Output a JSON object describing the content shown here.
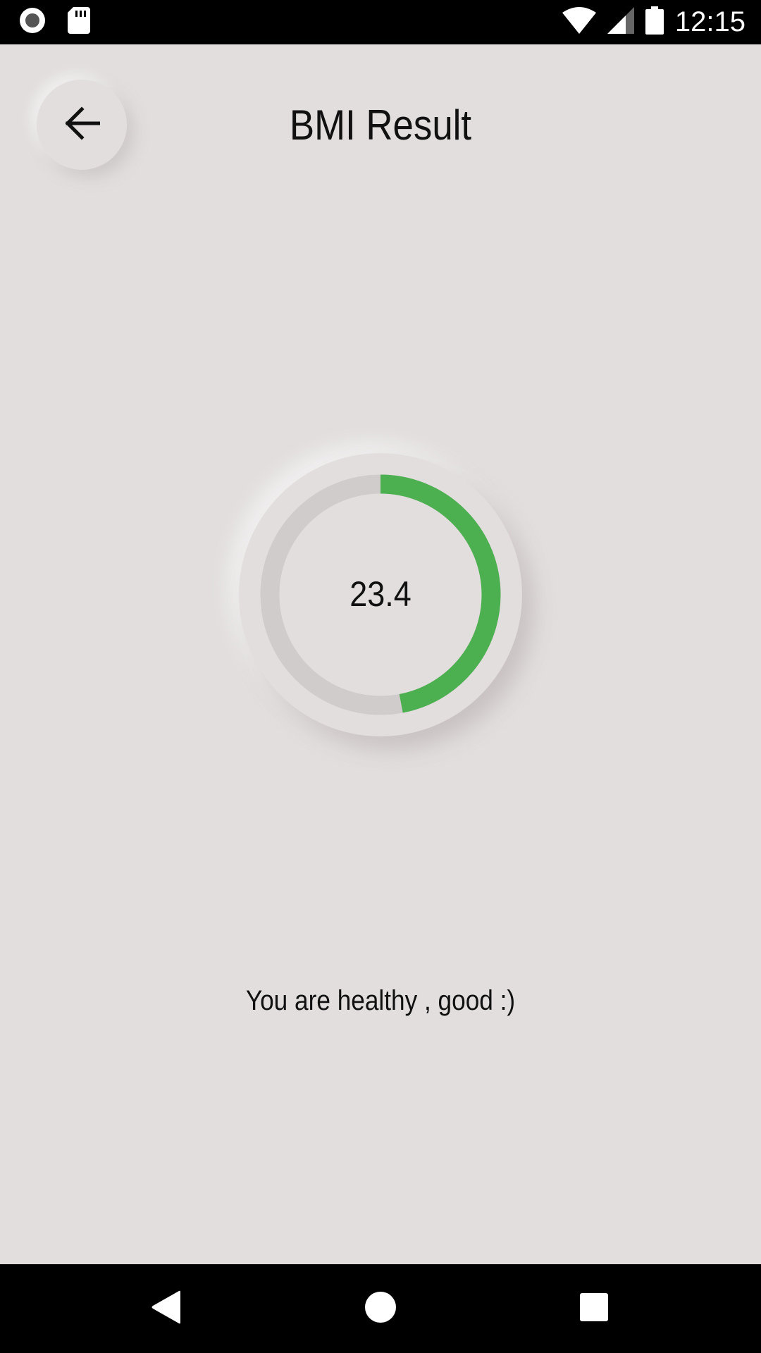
{
  "status_bar": {
    "time": "12:15",
    "icons": [
      "record-icon",
      "sd-card-icon",
      "wifi-icon",
      "cell-signal-icon",
      "battery-icon"
    ]
  },
  "header": {
    "title": "BMI Result",
    "back_icon": "arrow-left-icon"
  },
  "result": {
    "bmi_value": "23.4",
    "progress_fraction": 0.47,
    "message": "You are healthy , good :)"
  },
  "colors": {
    "background": "#e2dede",
    "progress": "#4caf50",
    "track": "#cfcccb",
    "text": "#111111"
  },
  "nav_bar": {
    "icons": [
      "back-triangle-icon",
      "home-circle-icon",
      "recents-square-icon"
    ]
  }
}
